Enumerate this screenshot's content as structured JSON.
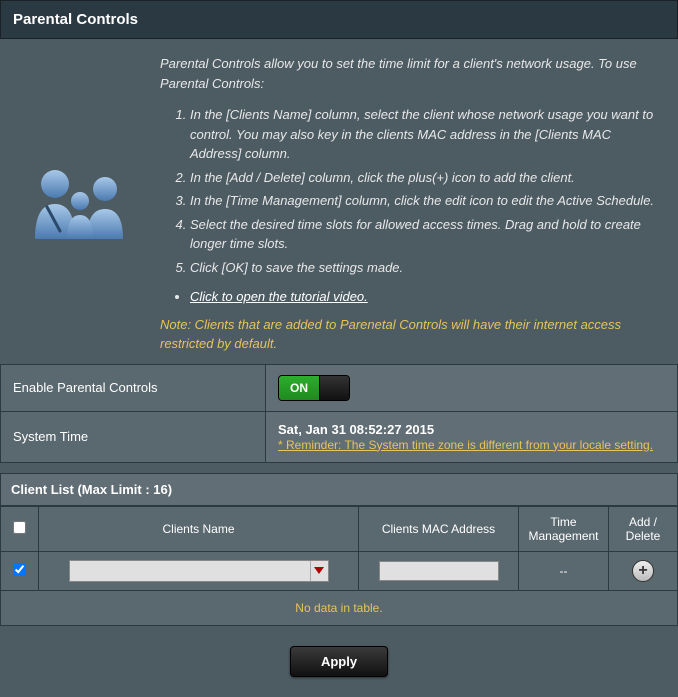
{
  "title": "Parental Controls",
  "intro": "Parental Controls allow you to set the time limit for a client's network usage. To use Parental Controls:",
  "steps": [
    "In the [Clients Name] column, select the client whose network usage you want to control. You may also key in the clients MAC address in the [Clients MAC Address] column.",
    "In the [Add / Delete] column, click the plus(+) icon to add the client.",
    "In the [Time Management] column, click the edit icon to edit the Active Schedule.",
    "Select the desired time slots for allowed access times. Drag and hold to create longer time slots.",
    "Click [OK] to save the settings made."
  ],
  "tutorial_link": "Click to open the tutorial video.",
  "note": "Note: Clients that are added to Parenetal Controls will have their internet access restricted by default.",
  "settings": {
    "enable_label": "Enable Parental Controls",
    "toggle_on": "ON",
    "system_time_label": "System Time",
    "system_time_value": "Sat, Jan 31 08:52:27 2015",
    "reminder": "* Reminder: The System time zone is different from your locale setting."
  },
  "client_list": {
    "header": "Client List (Max Limit : 16)",
    "columns": {
      "name": "Clients Name",
      "mac": "Clients MAC Address",
      "time": "Time Management",
      "add": "Add / Delete"
    },
    "row": {
      "name_value": "",
      "mac_value": "",
      "time_value": "--"
    },
    "empty": "No data in table."
  },
  "apply_label": "Apply"
}
